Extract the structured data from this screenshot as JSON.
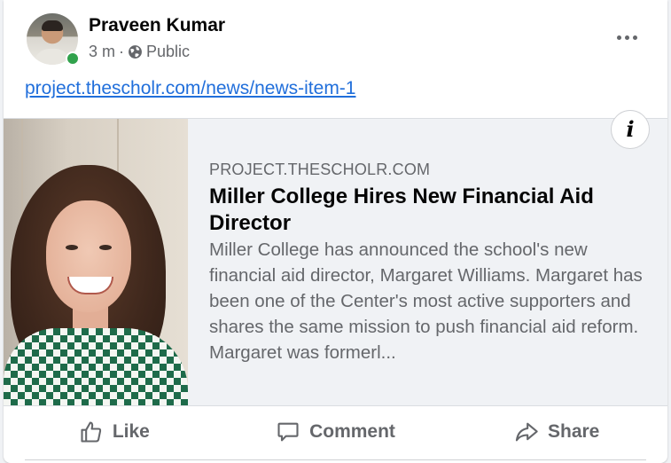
{
  "post": {
    "author": "Praveen Kumar",
    "time": "3 m",
    "separator": "·",
    "audience": "Public",
    "link_text": "project.thescholr.com/news/news-item-1"
  },
  "preview": {
    "domain": "PROJECT.THESCHOLR.COM",
    "title": "Miller College Hires New Financial Aid Director",
    "description": "Miller College has announced the school's new financial aid director, Margaret Williams. Margaret has been one of the Center's most active supporters and shares the same mission to push financial aid reform. Margaret was formerl...",
    "info_glyph": "i"
  },
  "actions": {
    "like": "Like",
    "comment": "Comment",
    "share": "Share"
  },
  "icons": {
    "more": "more-options-icon",
    "globe": "globe-icon",
    "info": "info-icon",
    "like": "thumbs-up-icon",
    "comment": "comment-bubble-icon",
    "share": "share-arrow-icon"
  },
  "colors": {
    "link": "#216fdb",
    "secondary_text": "#65676b",
    "online": "#31a24c"
  }
}
